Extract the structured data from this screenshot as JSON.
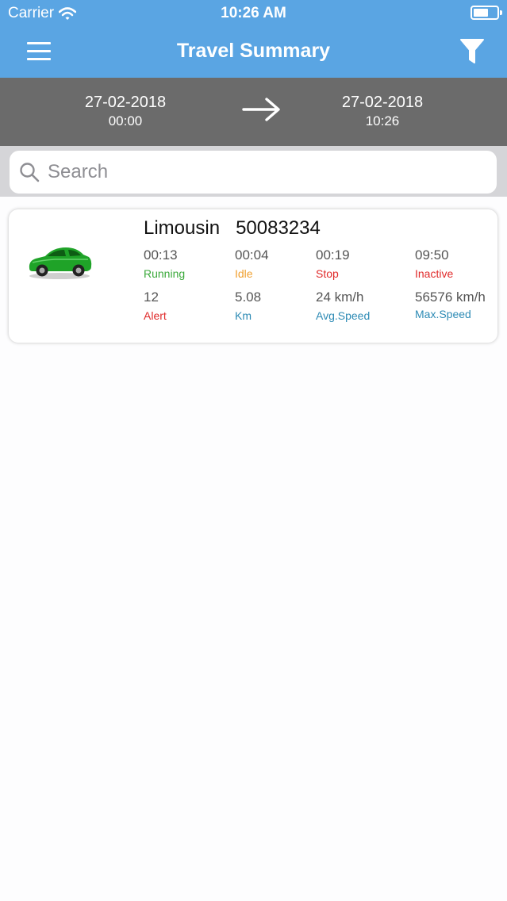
{
  "status_bar": {
    "carrier": "Carrier",
    "time": "10:26 AM"
  },
  "header": {
    "title": "Travel Summary"
  },
  "icons": {
    "menu": "hamburger-menu-icon",
    "filter": "funnel-filter-icon",
    "search": "magnifier-search-icon",
    "arrow": "right-arrow-icon",
    "wifi": "wifi-icon",
    "battery": "battery-icon",
    "vehicle": "green-car-icon"
  },
  "date_range": {
    "from": {
      "date": "27-02-2018",
      "time": "00:00"
    },
    "to": {
      "date": "27-02-2018",
      "time": "10:26"
    }
  },
  "search": {
    "placeholder": "Search",
    "value": ""
  },
  "vehicle": {
    "type": "Limousin",
    "id": "50083234",
    "stats": {
      "running": {
        "value": "00:13",
        "label": "Running"
      },
      "idle": {
        "value": "00:04",
        "label": "Idle"
      },
      "stop": {
        "value": "00:19",
        "label": "Stop"
      },
      "inactive": {
        "value": "09:50",
        "label": "Inactive"
      },
      "alert": {
        "value": "12",
        "label": "Alert"
      },
      "km": {
        "value": "5.08",
        "label": "Km"
      },
      "avg_speed": {
        "value": "24 km/h",
        "label": "Avg.Speed"
      },
      "max_speed": {
        "value": "56576 km/h",
        "label": "Max.Speed"
      }
    }
  },
  "colors": {
    "header_bg": "#5aa5e3",
    "date_bar_bg": "#6b6b6b",
    "running": "#3aa93a",
    "idle": "#f0a030",
    "stop": "#e02b2b",
    "inactive": "#e02b2b",
    "alert": "#e02b2b",
    "km": "#2e8bb5",
    "avg_speed": "#2e8bb5",
    "max_speed": "#2e8bb5"
  }
}
